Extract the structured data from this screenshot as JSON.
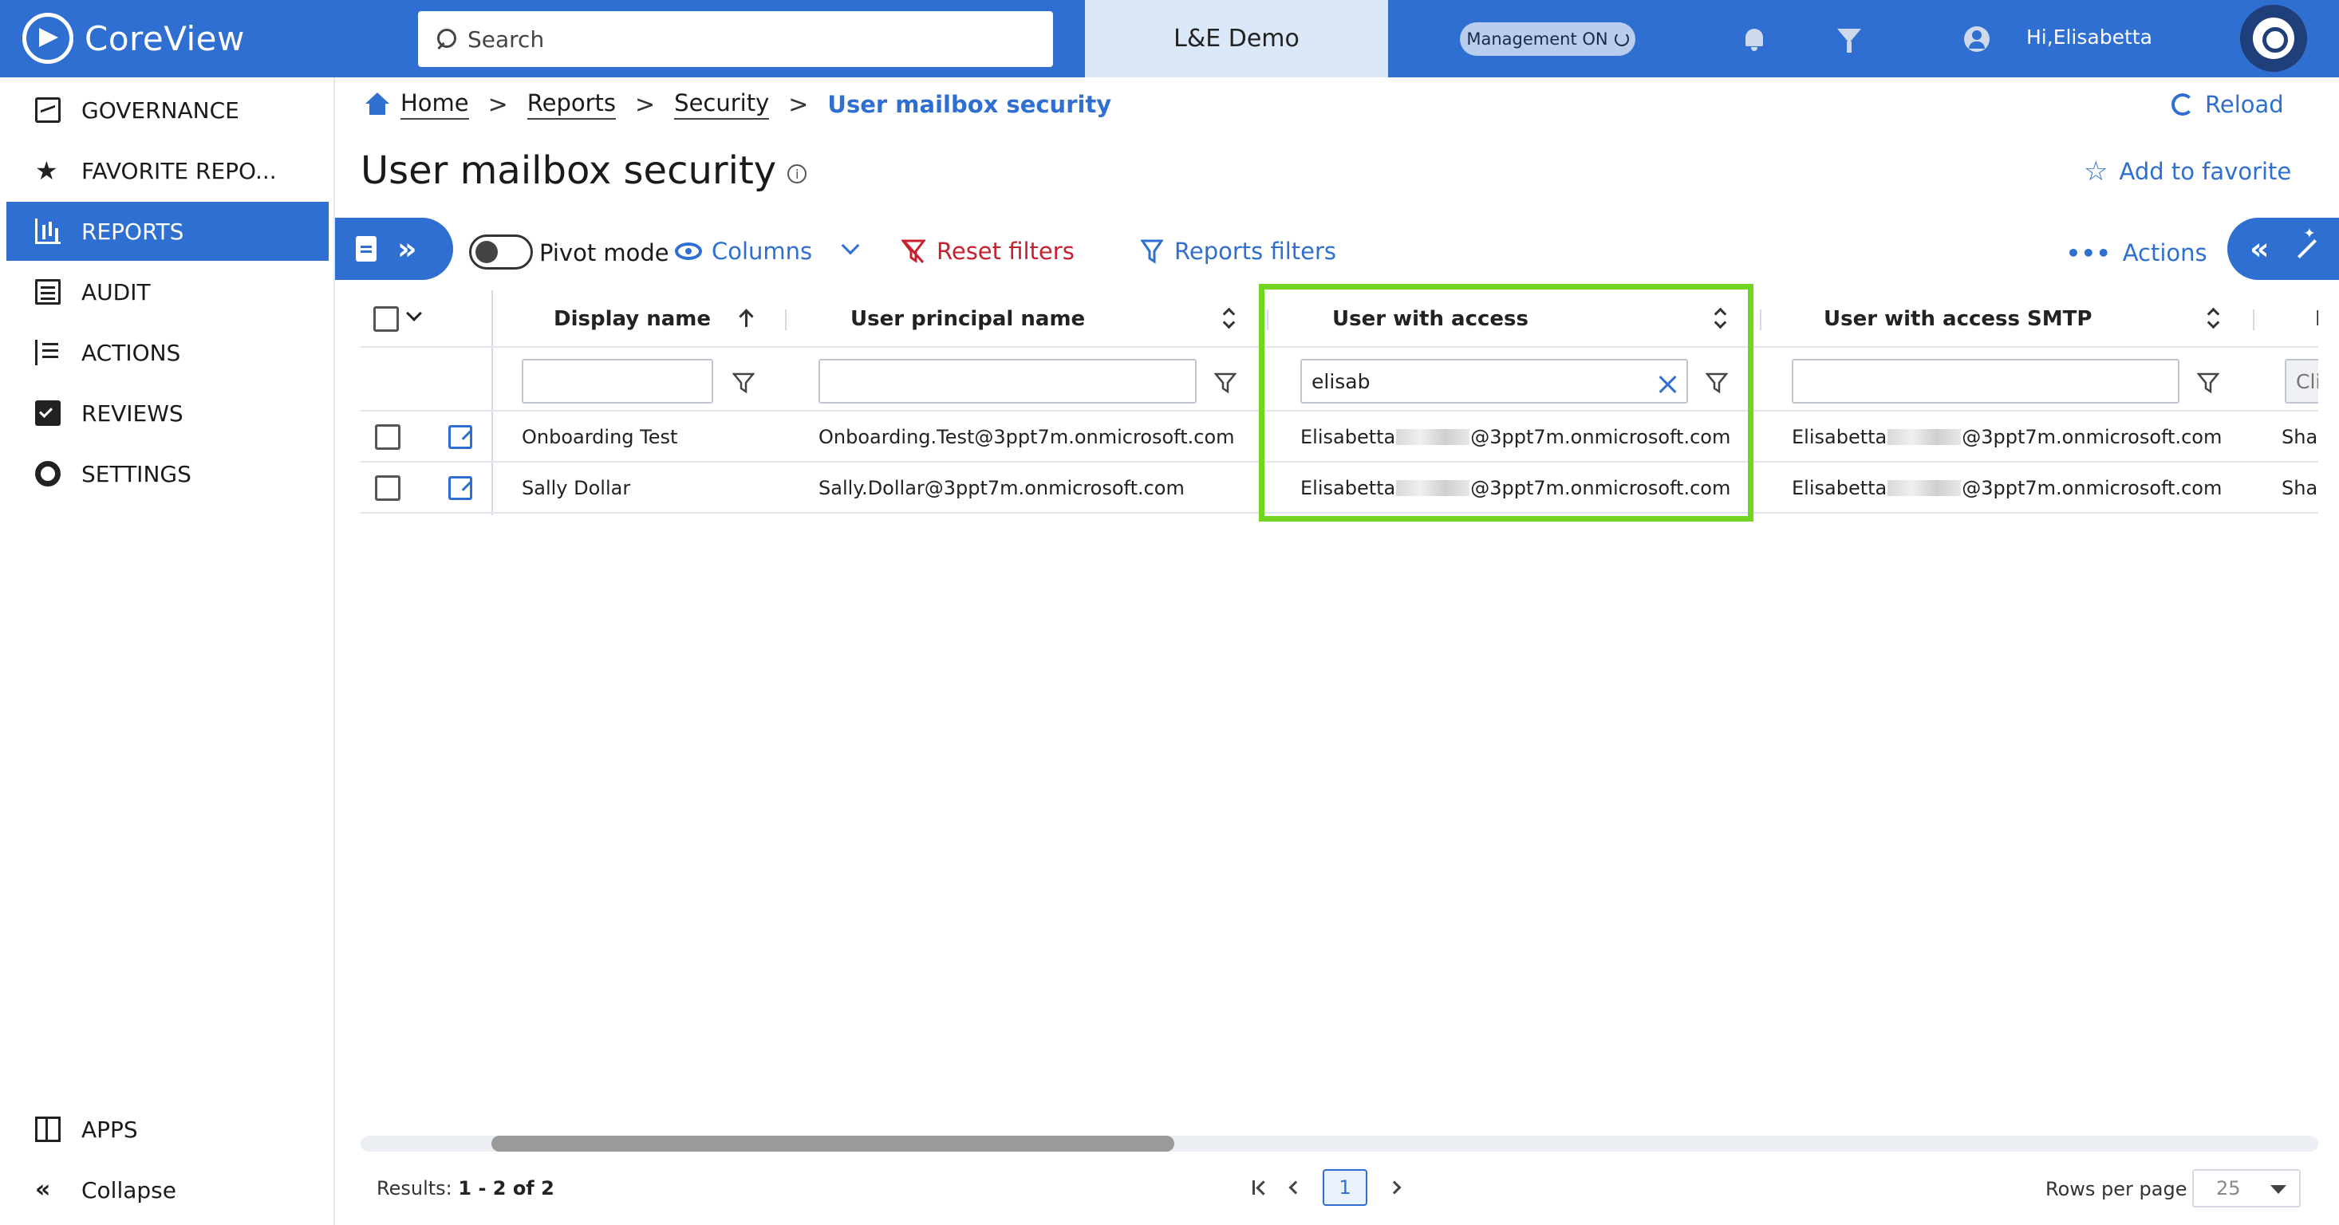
{
  "topbar": {
    "brand": "CoreView",
    "search_placeholder": "Search",
    "tenant": "L&E Demo",
    "management": "Management ON",
    "greeting": "Hi,Elisabetta"
  },
  "sidebar": {
    "items": [
      {
        "label": "GOVERNANCE"
      },
      {
        "label": "FAVORITE REPO..."
      },
      {
        "label": "REPORTS"
      },
      {
        "label": "AUDIT"
      },
      {
        "label": "ACTIONS"
      },
      {
        "label": "REVIEWS"
      },
      {
        "label": "SETTINGS"
      }
    ],
    "apps": "APPS",
    "collapse": "Collapse",
    "active_color": "#2f6fd1"
  },
  "breadcrumb": {
    "home": "Home",
    "reports": "Reports",
    "security": "Security",
    "current": "User mailbox security",
    "separator": ">"
  },
  "page": {
    "title": "User mailbox security",
    "reload": "Reload",
    "add_favorite": "Add to favorite"
  },
  "toolbar": {
    "pivot_mode": "Pivot mode",
    "columns": "Columns",
    "reset_filters": "Reset filters",
    "reports_filters": "Reports filters",
    "actions": "Actions"
  },
  "grid": {
    "columns": [
      {
        "label": "Display name"
      },
      {
        "label": "User principal name"
      },
      {
        "label": "User with access"
      },
      {
        "label": "User with access SMTP"
      },
      {
        "label": "I"
      }
    ],
    "filters": {
      "display_name": "",
      "user_principal_name": "",
      "user_with_access": "elisab",
      "user_with_access_smtp": "",
      "next_col_placeholder": "Cli"
    },
    "rows": [
      {
        "display_name": "Onboarding Test",
        "upn": "Onboarding.Test@3ppt7m.onmicrosoft.com",
        "access_prefix": "Elisabetta",
        "access_suffix": "@3ppt7m.onmicrosoft.com",
        "smtp_prefix": "Elisabetta",
        "smtp_suffix": "@3ppt7m.onmicrosoft.com",
        "next": "Shar"
      },
      {
        "display_name": "Sally Dollar",
        "upn": "Sally.Dollar@3ppt7m.onmicrosoft.com",
        "access_prefix": "Elisabetta",
        "access_suffix": "@3ppt7m.onmicrosoft.com",
        "smtp_prefix": "Elisabetta",
        "smtp_suffix": "@3ppt7m.onmicrosoft.com",
        "next": "Shar"
      }
    ],
    "highlight_color": "#72d51f"
  },
  "footer": {
    "results_label": "Results:",
    "results_value": "1 - 2 of 2",
    "current_page": "1",
    "rows_per_page_label": "Rows per page",
    "rows_per_page": "25"
  }
}
